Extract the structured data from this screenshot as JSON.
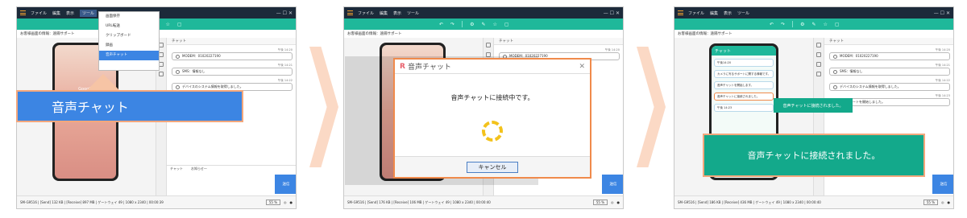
{
  "menu": {
    "file": "ファイル",
    "edit": "編集",
    "display": "表示",
    "tools": "ツール"
  },
  "window_buttons": "— ☐ ✕",
  "info_text": "お客様画面の情報：遠隔サポート",
  "dropdown_items": [
    "画面保存",
    "URL転送",
    "クリップボード",
    "録画",
    "音声チャット"
  ],
  "callout_panel1": "音声チャット",
  "chat": {
    "header": "チャット",
    "messages": [
      {
        "time": "午後 14:20",
        "text": "MODEM：01020227190"
      },
      {
        "time": "午後 14:21",
        "text": "SMS：情報なし"
      },
      {
        "time": "午後 14:22",
        "text": "デバイスのシステム情報を取得しました。"
      },
      {
        "time": "午後 14:23",
        "text": "遠隔サポートを開始しました。"
      }
    ],
    "tab_chat": "チャット",
    "tab_notice": "お知らせ一",
    "send": "送信"
  },
  "status_panels": [
    "SM-G9516 | [Send] 132 KB | [Receive] 897 MB | ゲートウェイ 49 | 1080 x 2340 | 00:00:39",
    "SM-G9516 | [Send] 176 KB | [Receive] 106 MB | ゲートウェイ 49 | 1080 x 2340 | 00:00:40",
    "SM-G9516 | [Send] 186 KB | [Receive] 436 MB | ゲートウェイ 49 | 1080 x 2340 | 00:00:40"
  ],
  "zoom": "55 %",
  "phone_time": "Google",
  "dialog": {
    "title": "音声チャット",
    "message": "音声チャットに接続中です。",
    "cancel": "キャンセル"
  },
  "app3": {
    "header": "チャット",
    "rows": [
      "午後14:20",
      "カメラに写るサポートに関する情報です。",
      "音声チャットを開始します。",
      "音声チャットに接続されました。",
      "午後 14:23"
    ]
  },
  "toast": "音声チャットに接続されました。",
  "callout_panel3": "音声チャットに接続されました。",
  "colors": {
    "titlebar": "#1c2a3a",
    "toolbar": "#1fb89a",
    "accent_blue": "#3c85e3",
    "accent_orange": "#f08a4b"
  }
}
